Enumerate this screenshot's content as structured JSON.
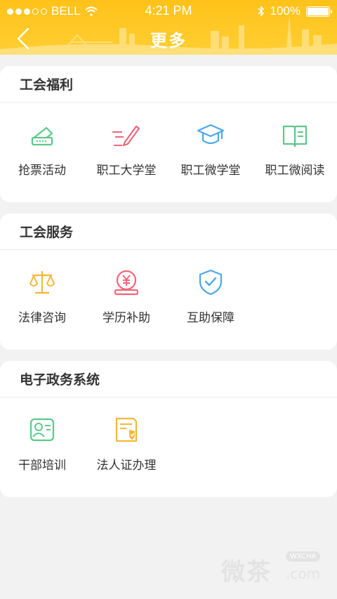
{
  "status_bar": {
    "carrier": "BELL",
    "time": "4:21 PM",
    "battery": "100%",
    "signal_bars_filled": 3,
    "signal_bars_total": 5
  },
  "nav": {
    "title": "更多",
    "back_icon": "chevron-left-icon"
  },
  "sections": [
    {
      "title": "工会福利",
      "items": [
        {
          "label": "抢票活动",
          "icon": "ticket-icon",
          "color": "#5cc98a"
        },
        {
          "label": "职工大学堂",
          "icon": "pen-icon",
          "color": "#f2667a"
        },
        {
          "label": "职工微学堂",
          "icon": "graduation-cap-icon",
          "color": "#4aa8e8"
        },
        {
          "label": "职工微阅读",
          "icon": "book-icon",
          "color": "#5cc98a"
        }
      ]
    },
    {
      "title": "工会服务",
      "items": [
        {
          "label": "法律咨询",
          "icon": "scales-icon",
          "color": "#f5b73b"
        },
        {
          "label": "学历补助",
          "icon": "yuan-coin-icon",
          "color": "#f2667a"
        },
        {
          "label": "互助保障",
          "icon": "shield-check-icon",
          "color": "#4aa8e8"
        }
      ]
    },
    {
      "title": "电子政务系统",
      "items": [
        {
          "label": "干部培训",
          "icon": "id-card-icon",
          "color": "#5cc98a"
        },
        {
          "label": "法人证办理",
          "icon": "certificate-icon",
          "color": "#f5b73b"
        }
      ]
    }
  ],
  "watermark": {
    "text": "微茶",
    "badge": "WXCHA",
    "domain": ".com"
  }
}
